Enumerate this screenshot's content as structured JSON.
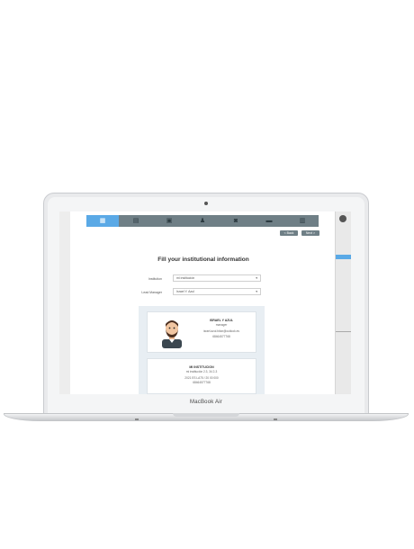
{
  "laptop": {
    "brand": "MacBook Air"
  },
  "app": {
    "steps": [
      "institution-icon",
      "clipboard-icon",
      "presentation-icon",
      "team-icon",
      "camera-icon",
      "bed-icon",
      "document-icon"
    ],
    "back_label": "< Back",
    "next_label": "Next >",
    "title": "Fill your institutional information",
    "institution": {
      "label": "Institution",
      "value": "mi institución"
    },
    "lead_manager": {
      "label": "Lead Manager",
      "value": "Israel Y. Azul"
    },
    "manager_card": {
      "name": "ISRAEL Y AZUL",
      "role": "manager",
      "email": "israel.azul.biton@outlook.es",
      "phone": "68464577768"
    },
    "institution_card": {
      "name": "MI INSTITUCION",
      "address": "mi institución 2.3, 34 2-3",
      "line2": "2021 ES LA75 / 20 00 000",
      "phone": "68464577768"
    },
    "accent_color": "#5aa9e6",
    "bar_color": "#6f7f86"
  }
}
